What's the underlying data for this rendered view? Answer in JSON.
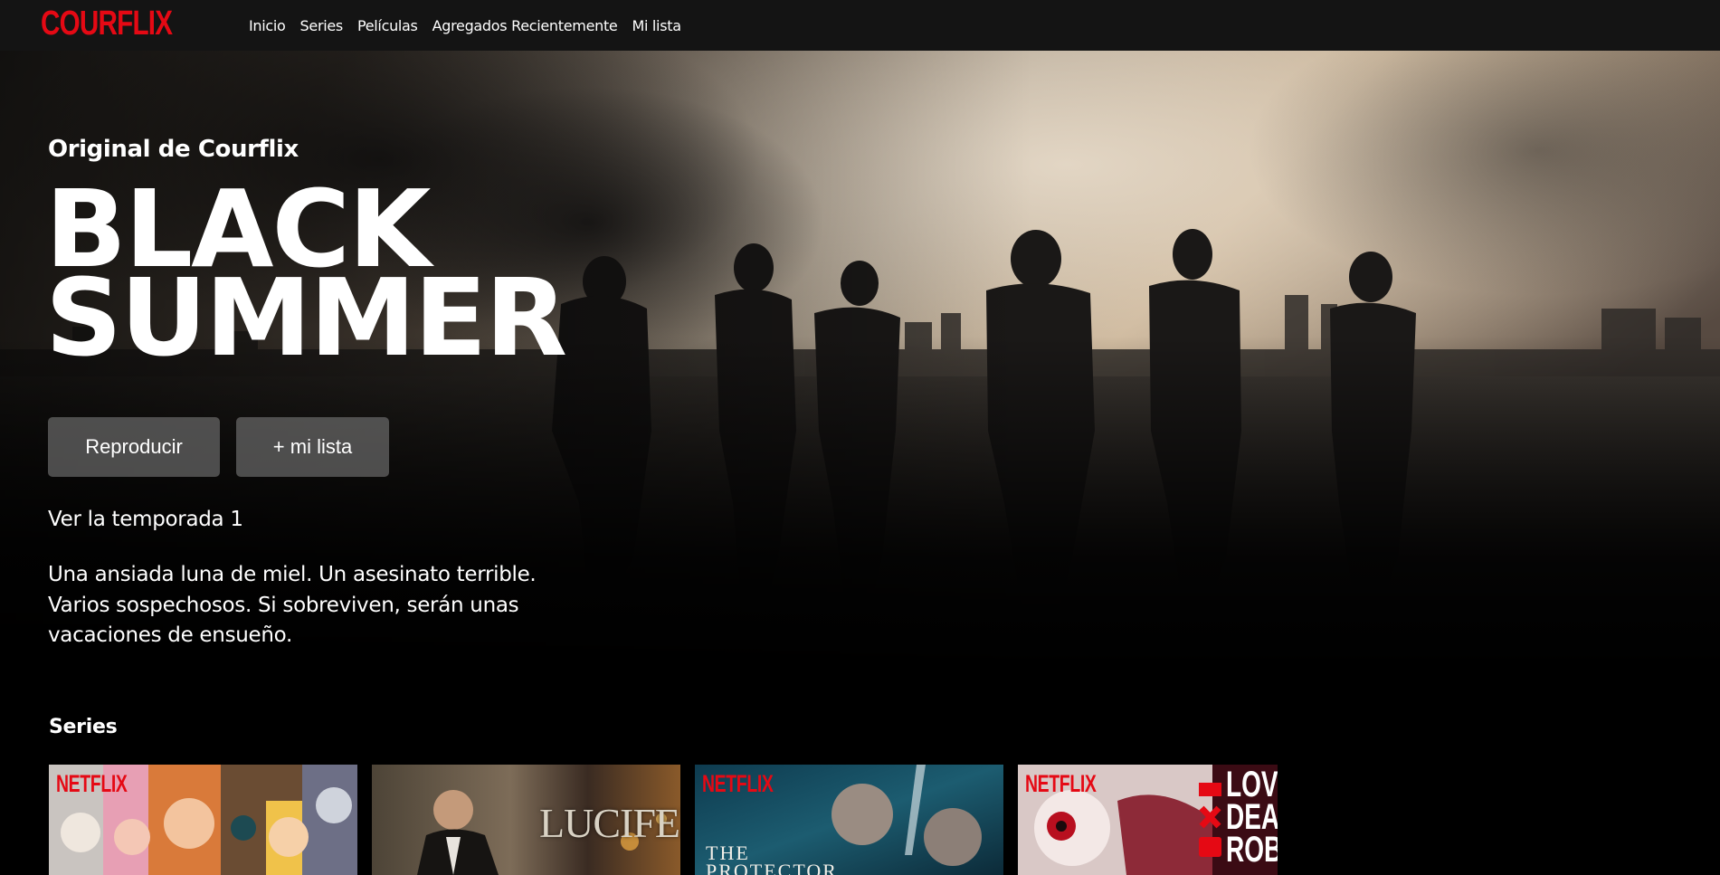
{
  "app": {
    "logo": "COURFLIX",
    "brand_color": "#e50914"
  },
  "nav": {
    "items": [
      {
        "label": "Inicio"
      },
      {
        "label": "Series"
      },
      {
        "label": "Películas"
      },
      {
        "label": "Agregados Recientemente"
      },
      {
        "label": "Mi lista"
      }
    ]
  },
  "hero": {
    "kicker": "Original de Courflix",
    "title_line1": "BLACK",
    "title_line2": "SUMMER",
    "play_label": "Reproducir",
    "add_list_label": "+ mi lista",
    "season": "Ver la temporada 1",
    "synopsis": "Una ansiada luna de miel. Un asesinato terrible. Varios sospechosos. Si sobreviven, serán unas vacaciones de ensueño."
  },
  "rows": [
    {
      "title": "Series",
      "items": [
        {
          "badge": "NETFLIX",
          "title": ""
        },
        {
          "badge": "",
          "title": "LUCIFER"
        },
        {
          "badge": "NETFLIX",
          "title": "THE\nPROTECTOR"
        },
        {
          "badge": "NETFLIX",
          "title": "LOV\nDEA\nROB"
        }
      ]
    }
  ],
  "icons": {
    "play": "play-icon"
  }
}
